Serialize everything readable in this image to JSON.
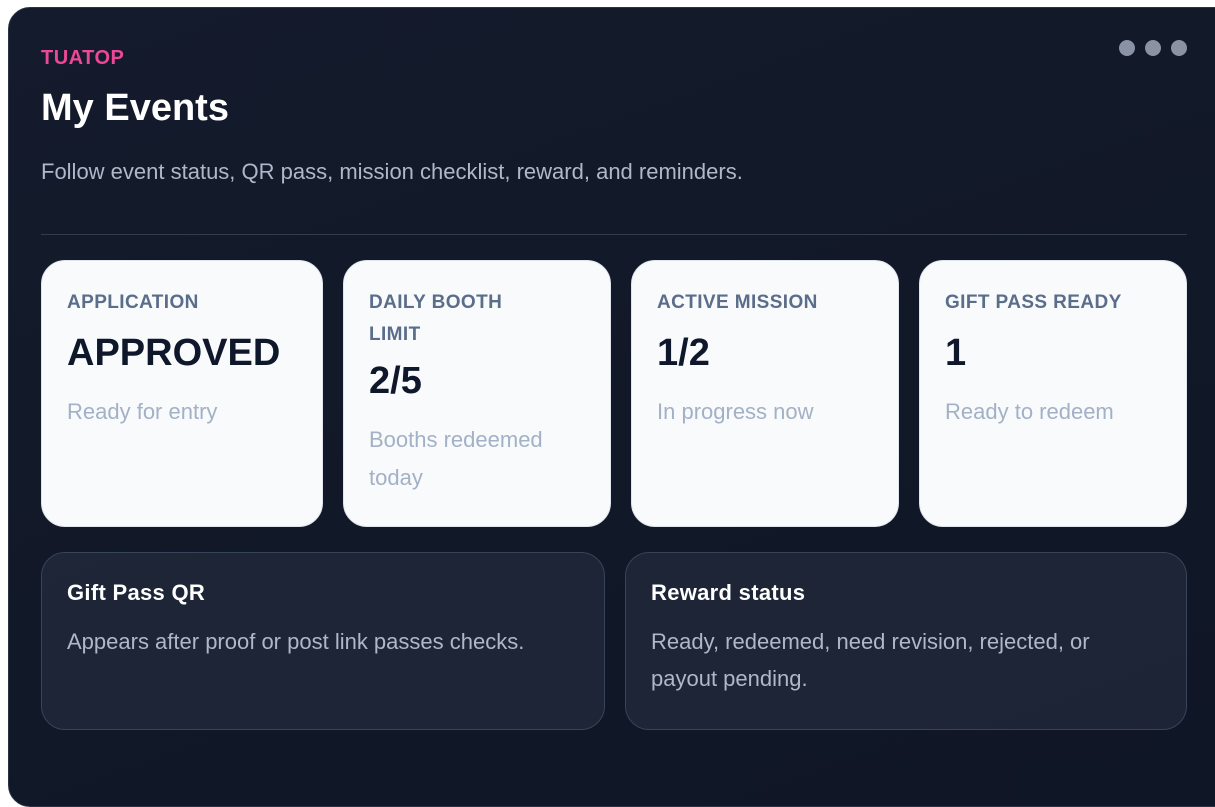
{
  "header": {
    "brand": "TUATOP",
    "title": "My Events",
    "subtitle": "Follow event status, QR pass, mission checklist, reward, and reminders.",
    "menu_icon": "more-dots-icon"
  },
  "stats": [
    {
      "label": "APPLICATION",
      "value": "APPROVED",
      "note": "Ready for entry"
    },
    {
      "label": "DAILY BOOTH LIMIT",
      "value": "2/5",
      "note": "Booths redeemed today"
    },
    {
      "label": "ACTIVE MISSION",
      "value": "1/2",
      "note": "In progress now"
    },
    {
      "label": "GIFT PASS READY",
      "value": "1",
      "note": "Ready to redeem"
    }
  ],
  "info_cards": [
    {
      "title": "Gift Pass QR",
      "text": "Appears after proof or post link passes checks."
    },
    {
      "title": "Reward status",
      "text": "Ready, redeemed, need revision, rejected, or payout pending."
    }
  ],
  "colors": {
    "brand_accent": "#ec4899",
    "panel_background": "#111827",
    "card_background": "#f8fafc"
  }
}
